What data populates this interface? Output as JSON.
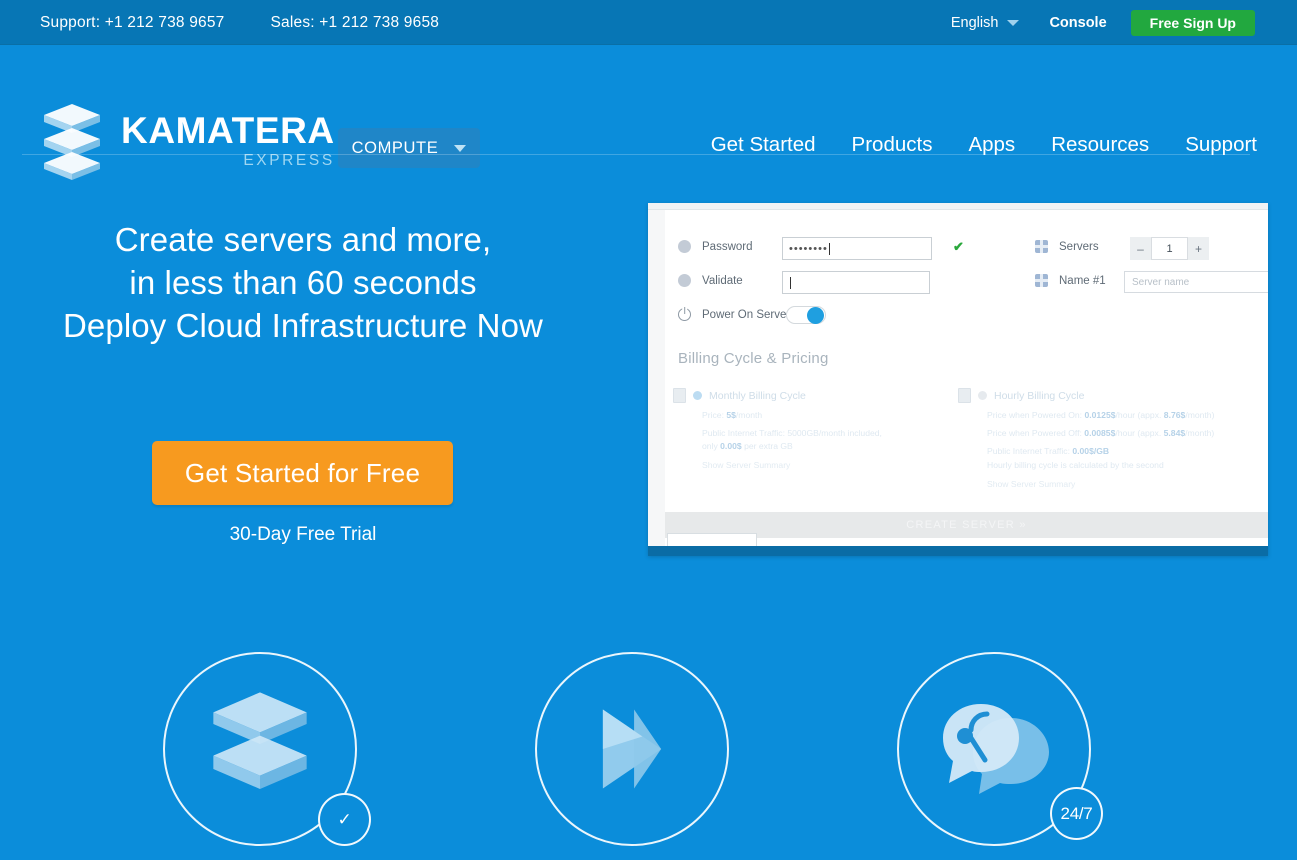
{
  "topbar": {
    "support_phone": "Support: +1 212 738 9657",
    "sales_phone": "Sales: +1 212 738 9658",
    "language": "English",
    "language_caret": "chevron-down-icon",
    "console": "Console",
    "signup": "Free Sign Up",
    "background": "#0776b5",
    "signup_color": "#22a83f"
  },
  "brand": {
    "name": "KAMATERA",
    "sub": "EXPRESS",
    "logo_icon": "kamatera-layers-logo"
  },
  "compute": {
    "label": "COMPUTE",
    "caret": "chevron-down-icon"
  },
  "nav": {
    "items": [
      {
        "label": "Get Started"
      },
      {
        "label": "Products"
      },
      {
        "label": "Apps"
      },
      {
        "label": "Resources"
      },
      {
        "label": "Support"
      }
    ]
  },
  "hero": {
    "line1": "Create servers and more,",
    "line2": "in less than 60 seconds",
    "line3": "Deploy Cloud Infrastructure Now",
    "cta": "Get Started for Free",
    "cta_color": "#f79a1f",
    "trial": "30-Day Free Trial"
  },
  "panel": {
    "fields": {
      "password_label": "Password",
      "password_value": "••••••••",
      "password_valid_icon": "green-check-icon",
      "validate_label": "Validate",
      "validate_value": "",
      "power_label": "Power On Servers",
      "power_state": "on",
      "servers_label": "Servers",
      "servers_count": "1",
      "servers_minus": "–",
      "servers_plus": "+",
      "name_label": "Name #1",
      "name_placeholder": "Server name"
    },
    "billing": {
      "section_title": "Billing Cycle & Pricing",
      "monthly": {
        "title": "Monthly Billing Cycle",
        "price_label": "Price:",
        "price_value": "5$",
        "price_unit": "/month",
        "traffic": "Public Internet Traffic: 5000GB/month included,",
        "traffic2_pre": "only",
        "traffic2_value": "0.00$",
        "traffic2_post": "per extra GB",
        "summary_link": "Show Server Summary"
      },
      "hourly": {
        "title": "Hourly Billing Cycle",
        "on_pre": "Price when Powered On:",
        "on_value": "0.0125$",
        "on_mid": "/hour (appx.",
        "on_month": "8.76$",
        "on_post": "/month)",
        "off_pre": "Price when Powered Off:",
        "off_value": "0.0085$",
        "off_mid": "/hour (appx.",
        "off_month": "5.84$",
        "off_post": "/month)",
        "traffic_pre": "Public Internet Traffic:",
        "traffic_value": "0.00$/GB",
        "note": "Hourly billing cycle is calculated by the second",
        "summary_link": "Show Server Summary"
      }
    },
    "create_button": "CREATE SERVER »"
  },
  "features": [
    {
      "icon": "kamatera-layers-logo",
      "badge": "check-mark-icon",
      "badge_text": "✓"
    },
    {
      "icon": "fast-forward-arrow-icon",
      "badge": null,
      "badge_text": ""
    },
    {
      "icon": "support-headset-icon",
      "badge": "twentyfour-seven-badge",
      "badge_text": "24/7"
    }
  ]
}
